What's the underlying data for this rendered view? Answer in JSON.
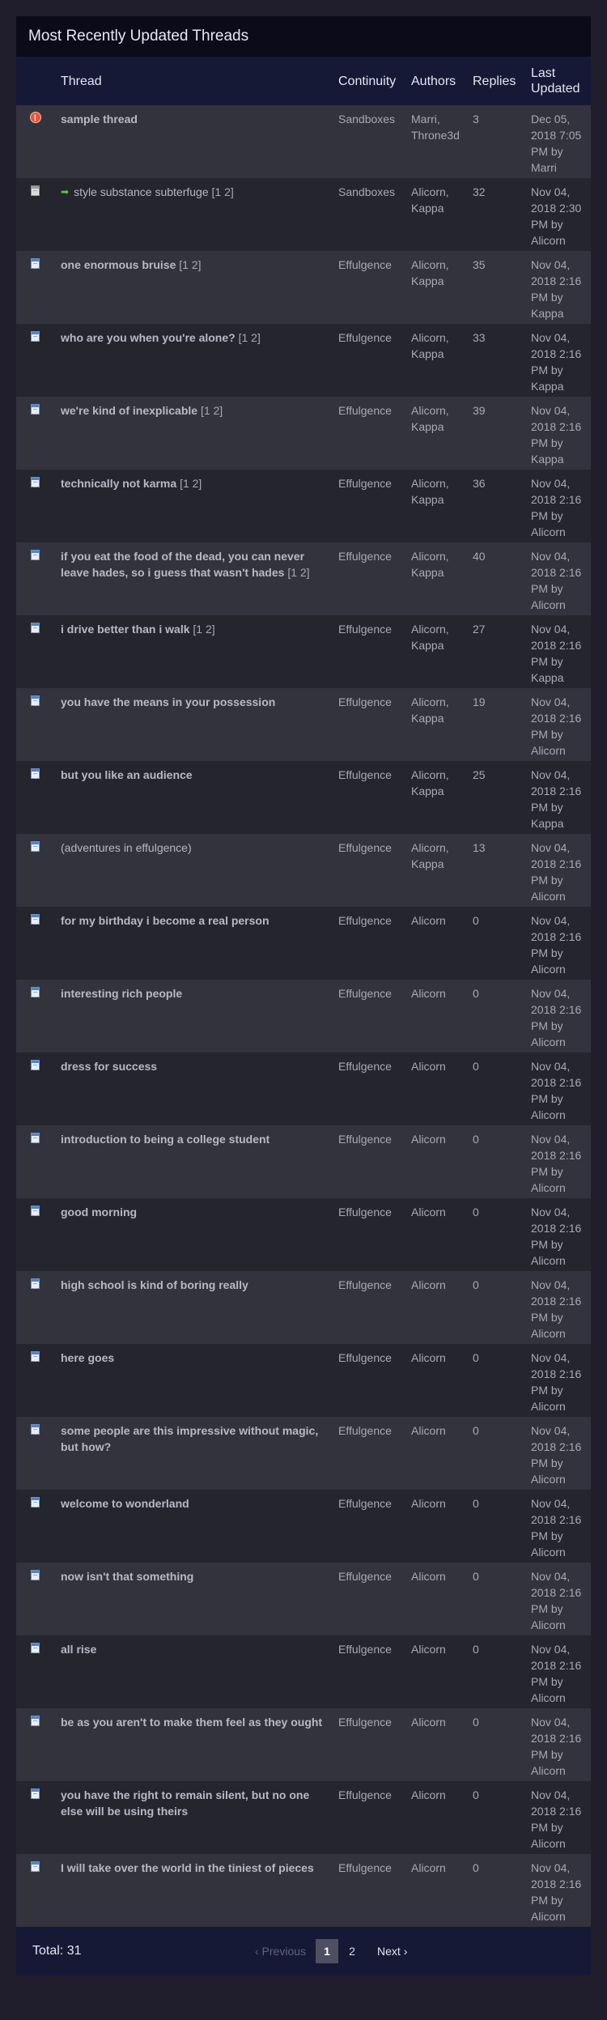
{
  "title": "Most Recently Updated Threads",
  "columns": {
    "thread": "Thread",
    "continuity": "Continuity",
    "authors": "Authors",
    "replies": "Replies",
    "last_updated": "Last Updated"
  },
  "rows": [
    {
      "icon": "warning-icon",
      "arrow": false,
      "bold": true,
      "title": "sample thread",
      "pages": "",
      "continuity": "Sandboxes",
      "authors": "Marri, Throne3d",
      "replies": "3",
      "date": "Dec 05, 2018 7:05 PM by",
      "by": "Marri"
    },
    {
      "icon": "gray-document-icon",
      "arrow": true,
      "bold": false,
      "title": "style substance subterfuge",
      "pages": "[1 2]",
      "continuity": "Sandboxes",
      "authors": "Alicorn, Kappa",
      "replies": "32",
      "date": "Nov 04, 2018 2:30 PM by",
      "by": "Alicorn"
    },
    {
      "icon": "document-icon",
      "arrow": false,
      "bold": true,
      "title": "one enormous bruise",
      "pages": "[1 2]",
      "continuity": "Effulgence",
      "authors": "Alicorn, Kappa",
      "replies": "35",
      "date": "Nov 04, 2018 2:16 PM by",
      "by": "Kappa"
    },
    {
      "icon": "document-icon",
      "arrow": false,
      "bold": true,
      "title": "who are you when you're alone?",
      "pages": "[1 2]",
      "continuity": "Effulgence",
      "authors": "Alicorn, Kappa",
      "replies": "33",
      "date": "Nov 04, 2018 2:16 PM by",
      "by": "Kappa"
    },
    {
      "icon": "document-icon",
      "arrow": false,
      "bold": true,
      "title": "we're kind of inexplicable",
      "pages": "[1 2]",
      "continuity": "Effulgence",
      "authors": "Alicorn, Kappa",
      "replies": "39",
      "date": "Nov 04, 2018 2:16 PM by",
      "by": "Kappa"
    },
    {
      "icon": "document-icon",
      "arrow": false,
      "bold": true,
      "title": "technically not karma",
      "pages": "[1 2]",
      "continuity": "Effulgence",
      "authors": "Alicorn, Kappa",
      "replies": "36",
      "date": "Nov 04, 2018 2:16 PM by",
      "by": "Alicorn"
    },
    {
      "icon": "document-icon",
      "arrow": false,
      "bold": true,
      "title": "if you eat the food of the dead, you can never leave hades, so i guess that wasn't hades",
      "pages": "[1 2]",
      "continuity": "Effulgence",
      "authors": "Alicorn, Kappa",
      "replies": "40",
      "date": "Nov 04, 2018 2:16 PM by",
      "by": "Alicorn"
    },
    {
      "icon": "document-icon",
      "arrow": false,
      "bold": true,
      "title": "i drive better than i walk",
      "pages": "[1 2]",
      "continuity": "Effulgence",
      "authors": "Alicorn, Kappa",
      "replies": "27",
      "date": "Nov 04, 2018 2:16 PM by",
      "by": "Kappa"
    },
    {
      "icon": "document-icon",
      "arrow": false,
      "bold": true,
      "title": "you have the means in your possession",
      "pages": "",
      "continuity": "Effulgence",
      "authors": "Alicorn, Kappa",
      "replies": "19",
      "date": "Nov 04, 2018 2:16 PM by",
      "by": "Alicorn"
    },
    {
      "icon": "document-icon",
      "arrow": false,
      "bold": true,
      "title": "but you like an audience",
      "pages": "",
      "continuity": "Effulgence",
      "authors": "Alicorn, Kappa",
      "replies": "25",
      "date": "Nov 04, 2018 2:16 PM by",
      "by": "Kappa"
    },
    {
      "icon": "document-icon",
      "arrow": false,
      "bold": false,
      "title": "(adventures in effulgence)",
      "pages": "",
      "continuity": "Effulgence",
      "authors": "Alicorn, Kappa",
      "replies": "13",
      "date": "Nov 04, 2018 2:16 PM by",
      "by": "Alicorn"
    },
    {
      "icon": "document-icon",
      "arrow": false,
      "bold": true,
      "title": "for my birthday i become a real person",
      "pages": "",
      "continuity": "Effulgence",
      "authors": "Alicorn",
      "replies": "0",
      "date": "Nov 04, 2018 2:16 PM by",
      "by": "Alicorn"
    },
    {
      "icon": "document-icon",
      "arrow": false,
      "bold": true,
      "title": "interesting rich people",
      "pages": "",
      "continuity": "Effulgence",
      "authors": "Alicorn",
      "replies": "0",
      "date": "Nov 04, 2018 2:16 PM by",
      "by": "Alicorn"
    },
    {
      "icon": "document-icon",
      "arrow": false,
      "bold": true,
      "title": "dress for success",
      "pages": "",
      "continuity": "Effulgence",
      "authors": "Alicorn",
      "replies": "0",
      "date": "Nov 04, 2018 2:16 PM by",
      "by": "Alicorn"
    },
    {
      "icon": "document-icon",
      "arrow": false,
      "bold": true,
      "title": "introduction to being a college student",
      "pages": "",
      "continuity": "Effulgence",
      "authors": "Alicorn",
      "replies": "0",
      "date": "Nov 04, 2018 2:16 PM by",
      "by": "Alicorn"
    },
    {
      "icon": "document-icon",
      "arrow": false,
      "bold": true,
      "title": "good morning",
      "pages": "",
      "continuity": "Effulgence",
      "authors": "Alicorn",
      "replies": "0",
      "date": "Nov 04, 2018 2:16 PM by",
      "by": "Alicorn"
    },
    {
      "icon": "document-icon",
      "arrow": false,
      "bold": true,
      "title": "high school is kind of boring really",
      "pages": "",
      "continuity": "Effulgence",
      "authors": "Alicorn",
      "replies": "0",
      "date": "Nov 04, 2018 2:16 PM by",
      "by": "Alicorn"
    },
    {
      "icon": "document-icon",
      "arrow": false,
      "bold": true,
      "title": "here goes",
      "pages": "",
      "continuity": "Effulgence",
      "authors": "Alicorn",
      "replies": "0",
      "date": "Nov 04, 2018 2:16 PM by",
      "by": "Alicorn"
    },
    {
      "icon": "document-icon",
      "arrow": false,
      "bold": true,
      "title": "some people are this impressive without magic, but how?",
      "pages": "",
      "continuity": "Effulgence",
      "authors": "Alicorn",
      "replies": "0",
      "date": "Nov 04, 2018 2:16 PM by",
      "by": "Alicorn"
    },
    {
      "icon": "document-icon",
      "arrow": false,
      "bold": true,
      "title": "welcome to wonderland",
      "pages": "",
      "continuity": "Effulgence",
      "authors": "Alicorn",
      "replies": "0",
      "date": "Nov 04, 2018 2:16 PM by",
      "by": "Alicorn"
    },
    {
      "icon": "document-icon",
      "arrow": false,
      "bold": true,
      "title": "now isn't that something",
      "pages": "",
      "continuity": "Effulgence",
      "authors": "Alicorn",
      "replies": "0",
      "date": "Nov 04, 2018 2:16 PM by",
      "by": "Alicorn"
    },
    {
      "icon": "document-icon",
      "arrow": false,
      "bold": true,
      "title": "all rise",
      "pages": "",
      "continuity": "Effulgence",
      "authors": "Alicorn",
      "replies": "0",
      "date": "Nov 04, 2018 2:16 PM by",
      "by": "Alicorn"
    },
    {
      "icon": "document-icon",
      "arrow": false,
      "bold": true,
      "title": "be as you aren't to make them feel as they ought",
      "pages": "",
      "continuity": "Effulgence",
      "authors": "Alicorn",
      "replies": "0",
      "date": "Nov 04, 2018 2:16 PM by",
      "by": "Alicorn"
    },
    {
      "icon": "document-icon",
      "arrow": false,
      "bold": true,
      "title": "you have the right to remain silent, but no one else will be using theirs",
      "pages": "",
      "continuity": "Effulgence",
      "authors": "Alicorn",
      "replies": "0",
      "date": "Nov 04, 2018 2:16 PM by",
      "by": "Alicorn"
    },
    {
      "icon": "document-icon",
      "arrow": false,
      "bold": true,
      "title": "I will take over the world in the tiniest of pieces",
      "pages": "",
      "continuity": "Effulgence",
      "authors": "Alicorn",
      "replies": "0",
      "date": "Nov 04, 2018 2:16 PM by",
      "by": "Alicorn"
    }
  ],
  "footer": {
    "total": "Total: 31",
    "prev": "‹ Previous",
    "pages": [
      "1",
      "2"
    ],
    "current_page": "1",
    "next": "Next ›"
  },
  "colors": {
    "background": "#201e2d",
    "header": "#151936",
    "title_bar": "#0b0b1a",
    "row_odd": "#33333e",
    "row_even": "#25252e"
  }
}
